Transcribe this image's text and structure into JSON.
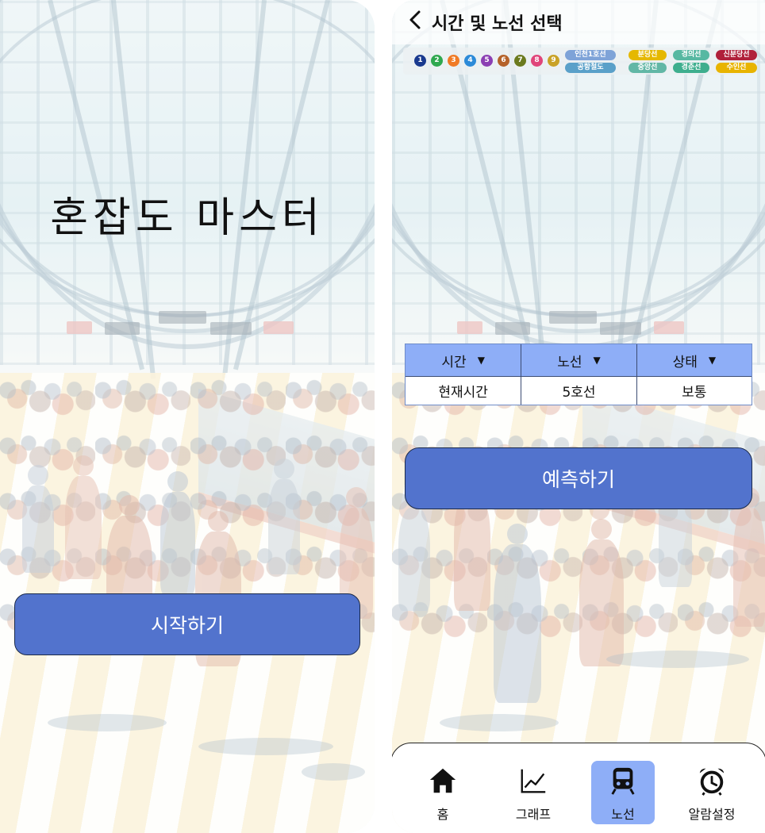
{
  "start_screen": {
    "title": "혼잡도 마스터",
    "start_button": "시작하기"
  },
  "select_screen": {
    "header": {
      "title": "시간 및 노선 선택"
    },
    "line_legend": {
      "numbered_lines": [
        {
          "label": "1",
          "color": "#1a3a8f"
        },
        {
          "label": "2",
          "color": "#2fa84f"
        },
        {
          "label": "3",
          "color": "#f07a25"
        },
        {
          "label": "4",
          "color": "#2c8ad8"
        },
        {
          "label": "5",
          "color": "#8b3fb3"
        },
        {
          "label": "6",
          "color": "#b5622a"
        },
        {
          "label": "7",
          "color": "#6b7a1e"
        },
        {
          "label": "8",
          "color": "#e0457a"
        },
        {
          "label": "9",
          "color": "#c9a227"
        }
      ],
      "named_lines": [
        {
          "label": "인천1호선",
          "color": "#7ea3d8"
        },
        {
          "label": "분당선",
          "color": "#e5b800"
        },
        {
          "label": "경의선",
          "color": "#57b8a2"
        },
        {
          "label": "신분당선",
          "color": "#b0203a"
        },
        {
          "label": "공항철도",
          "color": "#5aa0c9"
        },
        {
          "label": "중앙선",
          "color": "#62b7a6"
        },
        {
          "label": "경춘선",
          "color": "#3eae8e"
        },
        {
          "label": "수인선",
          "color": "#e8b400"
        }
      ]
    },
    "table": {
      "headers": [
        "시간",
        "노선",
        "상태"
      ],
      "values": [
        "현재시간",
        "5호선",
        "보통"
      ]
    },
    "predict_button": "예측하기",
    "nav": {
      "items": [
        {
          "label": "홈",
          "icon": "home-icon"
        },
        {
          "label": "그래프",
          "icon": "chart-icon"
        },
        {
          "label": "노선",
          "icon": "train-icon",
          "active": true
        },
        {
          "label": "알람설정",
          "icon": "alarm-clock-icon"
        }
      ]
    }
  }
}
